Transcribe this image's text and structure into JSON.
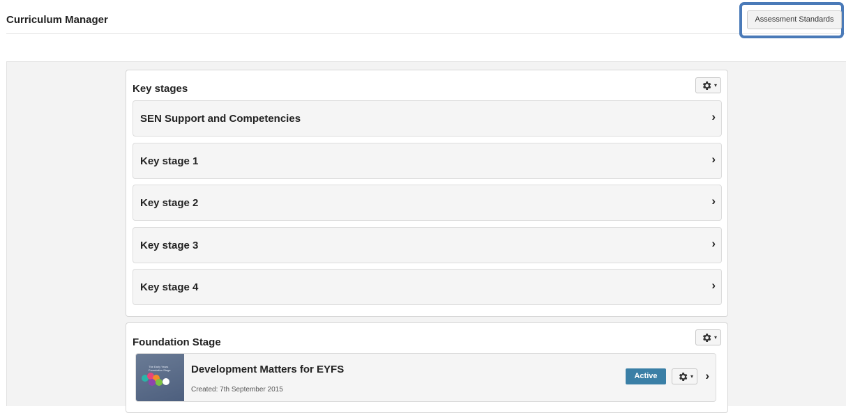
{
  "header": {
    "title": "Curriculum Manager",
    "assessment_button_label": "Assessment Standards"
  },
  "key_stages_panel": {
    "title": "Key stages",
    "items": [
      {
        "label": "SEN Support and Competencies"
      },
      {
        "label": "Key stage 1"
      },
      {
        "label": "Key stage 2"
      },
      {
        "label": "Key stage 3"
      },
      {
        "label": "Key stage 4"
      }
    ]
  },
  "foundation_panel": {
    "title": "Foundation Stage",
    "course": {
      "title": "Development Matters for EYFS",
      "created": "Created: 7th September 2015",
      "status": "Active",
      "thumbnail_text": "The Early Years Foundation Stage"
    }
  },
  "icons": {
    "gear": "gear-icon",
    "chevron": "chevron-right-icon",
    "caret": "caret-down-icon"
  },
  "colors": {
    "highlight": "#4a7ab8",
    "active_badge": "#3a7fa6"
  }
}
